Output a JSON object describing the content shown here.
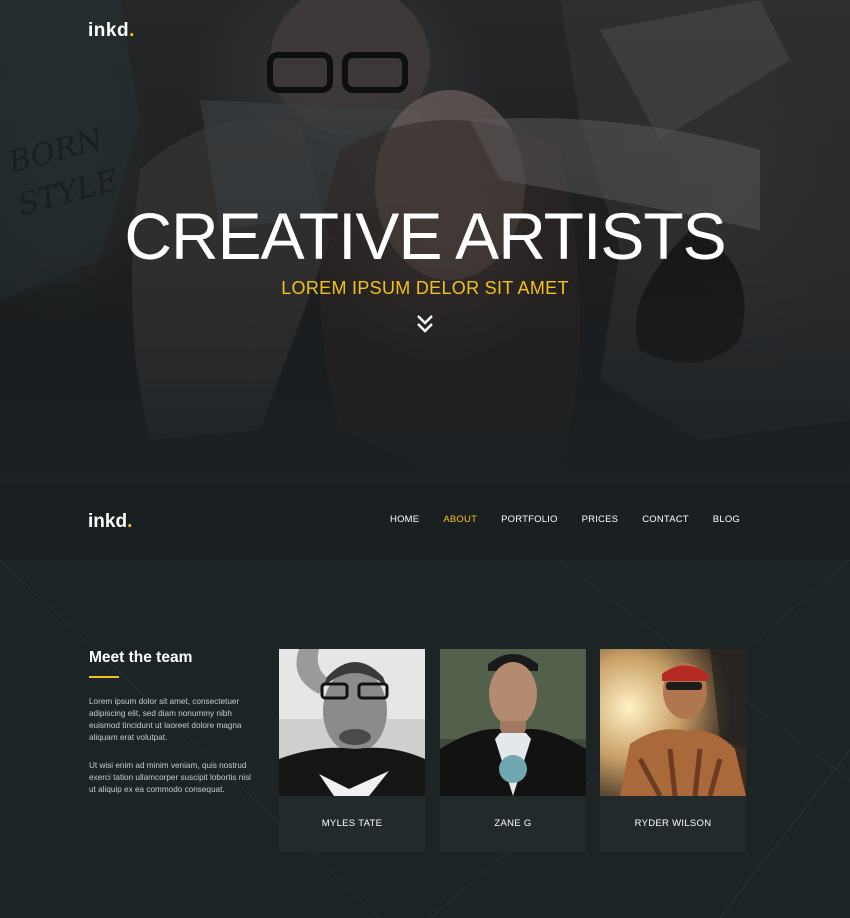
{
  "hero": {
    "logo_text": "inkd",
    "logo_dot": ".",
    "title": "CREATIVE ARTISTS",
    "subtitle": "LOREM IPSUM DELOR SIT AMET",
    "scroll_icon": "double-chevron-down-icon"
  },
  "nav": {
    "logo_text": "inkd",
    "logo_dot": ".",
    "items": [
      {
        "label": "HOME"
      },
      {
        "label": "ABOUT"
      },
      {
        "label": "PORTFOLIO"
      },
      {
        "label": "PRICES"
      },
      {
        "label": "CONTACT"
      },
      {
        "label": "BLOG"
      }
    ],
    "active_item": "ABOUT"
  },
  "team": {
    "heading": "Meet the team",
    "paragraph_1": "Lorem ipsum dolor sit amet, consectetuer adipiscing elit, sed diam nonummy nibh euismod tincidunt ut laoreet dolore magna aliquam erat volutpat.",
    "paragraph_2": "Ut wisi enim ad minim veniam, quis nostrud exerci tation ullamcorper suscipit lobortis nisl ut aliquip ex ea commodo consequat.",
    "members": [
      {
        "name": "MYLES TATE"
      },
      {
        "name": "ZANE G"
      },
      {
        "name": "RYDER WILSON"
      }
    ]
  },
  "colors": {
    "accent": "#f3c218",
    "background": "#1d2426",
    "nav_background": "#1a2022",
    "card_background": "#232a2c"
  }
}
